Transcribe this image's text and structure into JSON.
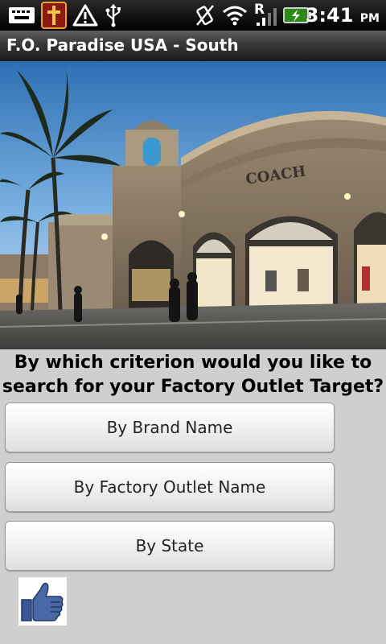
{
  "status_bar": {
    "time": "3:41",
    "ampm": "PM",
    "icons": [
      "keyboard-icon",
      "bible-app-icon",
      "warning-icon",
      "usb-icon",
      "vibrate-icon",
      "wifi-icon",
      "roaming-signal-icon",
      "battery-icon"
    ],
    "roaming_letter": "R"
  },
  "titlebar": {
    "title": "F.O. Paradise USA - South"
  },
  "hero": {
    "sign_text": "COACH"
  },
  "prompt": {
    "text": "By which criterion would you like to search for your Factory Outlet Target?"
  },
  "buttons": {
    "brand": "By Brand Name",
    "outlet": "By Factory Outlet Name",
    "state": "By State"
  },
  "like": {
    "icon": "thumbs-up-icon"
  }
}
